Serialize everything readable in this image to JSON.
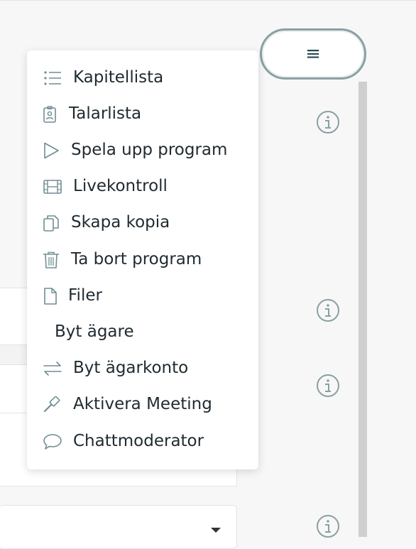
{
  "menu_button": {
    "icon": "≡"
  },
  "dropdown": {
    "items": [
      {
        "label": "Kapitellista",
        "icon": "list-icon"
      },
      {
        "label": "Talarlista",
        "icon": "badge-icon"
      },
      {
        "label": "Spela upp program",
        "icon": "play-icon"
      },
      {
        "label": "Livekontroll",
        "icon": "film-icon"
      },
      {
        "label": "Skapa kopia",
        "icon": "copy-icon"
      },
      {
        "label": "Ta bort program",
        "icon": "trash-icon"
      },
      {
        "label": "Filer",
        "icon": "file-icon"
      },
      {
        "label": "Byt ägare",
        "icon": ""
      },
      {
        "label": "Byt ägarkonto",
        "icon": "swap-arrows-icon"
      },
      {
        "label": "Aktivera Meeting",
        "icon": "gavel-icon"
      },
      {
        "label": "Chattmoderator",
        "icon": "chat-bubble-icon"
      }
    ]
  },
  "colors": {
    "icon": "#6f8e93",
    "text": "#1f2a30",
    "button_border": "#8aa0a3"
  }
}
